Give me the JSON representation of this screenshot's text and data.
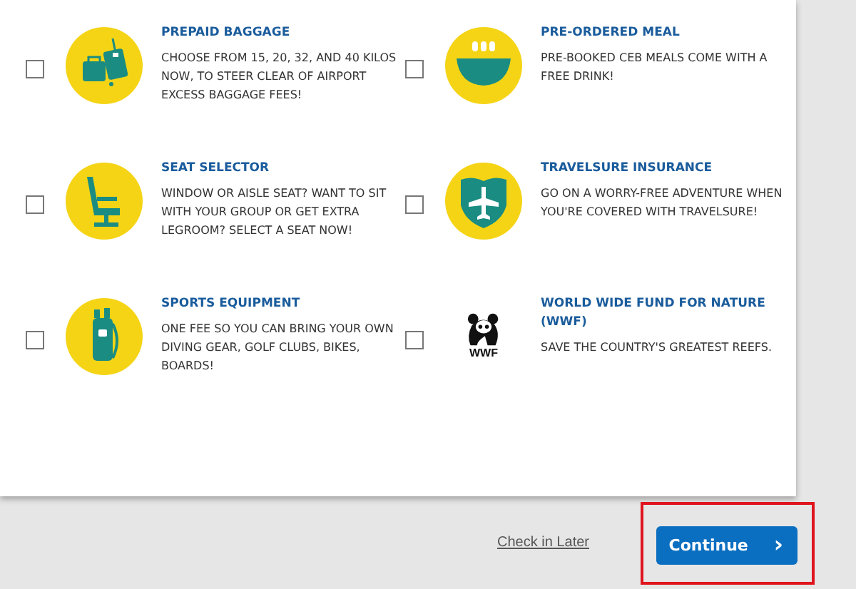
{
  "addons": [
    {
      "kind": "baggage",
      "title": "PREPAID BAGGAGE",
      "description": "CHOOSE FROM 15, 20, 32, AND 40 KILOS NOW, TO STEER CLEAR OF AIRPORT EXCESS BAGGAGE FEES!",
      "checked": false
    },
    {
      "kind": "meal",
      "title": "PRE-ORDERED MEAL",
      "description": "PRE-BOOKED CEB MEALS COME WITH A FREE DRINK!",
      "checked": false
    },
    {
      "kind": "seat",
      "title": "SEAT SELECTOR",
      "description": "WINDOW OR AISLE SEAT? WANT TO SIT WITH YOUR GROUP OR GET EXTRA LEGROOM? SELECT A SEAT NOW!",
      "checked": false
    },
    {
      "kind": "insurance",
      "title": "TRAVELSURE INSURANCE",
      "description": "GO ON A WORRY-FREE ADVENTURE WHEN YOU'RE COVERED WITH TRAVELSURE!",
      "checked": false
    },
    {
      "kind": "sports",
      "title": "SPORTS EQUIPMENT",
      "description": "ONE FEE SO YOU CAN BRING YOUR OWN DIVING GEAR, GOLF CLUBS, BIKES, BOARDS!",
      "checked": false
    },
    {
      "kind": "wwf",
      "logo_text": "WWF",
      "title": "WORLD WIDE FUND FOR NATURE (WWF)",
      "description": "SAVE THE COUNTRY'S GREATEST REEFS.",
      "checked": false
    }
  ],
  "footer": {
    "link": "Check in Later",
    "button": "Continue",
    "button_icon": "›"
  }
}
